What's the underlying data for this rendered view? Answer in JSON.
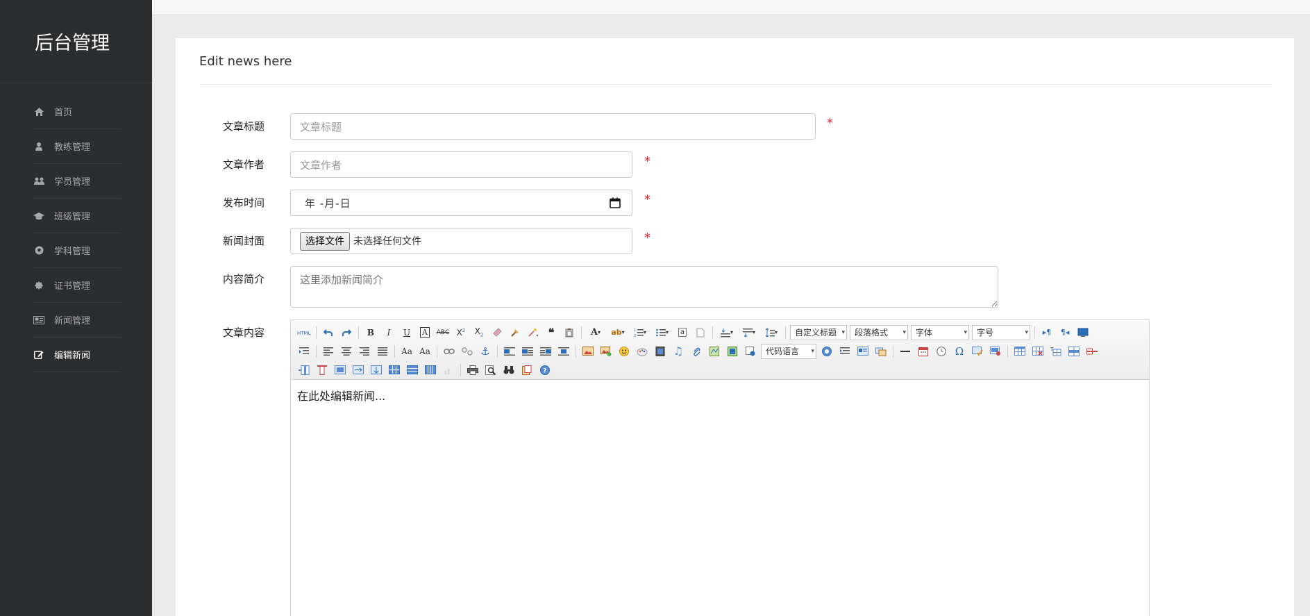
{
  "sidebar": {
    "brand": "后台管理",
    "items": [
      {
        "label": "首页",
        "icon": "home-icon"
      },
      {
        "label": "教练管理",
        "icon": "user-icon"
      },
      {
        "label": "学员管理",
        "icon": "users-icon"
      },
      {
        "label": "班级管理",
        "icon": "graduation-cap-icon"
      },
      {
        "label": "学科管理",
        "icon": "soccer-ball-icon"
      },
      {
        "label": "证书管理",
        "icon": "certificate-icon"
      },
      {
        "label": "新闻管理",
        "icon": "newspaper-icon"
      },
      {
        "label": "编辑新闻",
        "icon": "edit-icon"
      }
    ],
    "active_index": 7
  },
  "panel": {
    "title": "Edit news here"
  },
  "form": {
    "title_label": "文章标题",
    "title_placeholder": "文章标题",
    "author_label": "文章作者",
    "author_placeholder": "文章作者",
    "date_label": "发布时间",
    "date_value": "年 -月-日",
    "cover_label": "新闻封面",
    "cover_button": "选择文件",
    "cover_status": "未选择任何文件",
    "summary_label": "内容简介",
    "summary_placeholder": "这里添加新闻简介",
    "content_label": "文章内容",
    "required_mark": "*"
  },
  "editor": {
    "select_custom_title": "自定义标题",
    "select_paragraph": "段落格式",
    "select_font": "字体",
    "select_size": "字号",
    "select_code": "代码语言",
    "content": "在此处编辑新闻..."
  }
}
